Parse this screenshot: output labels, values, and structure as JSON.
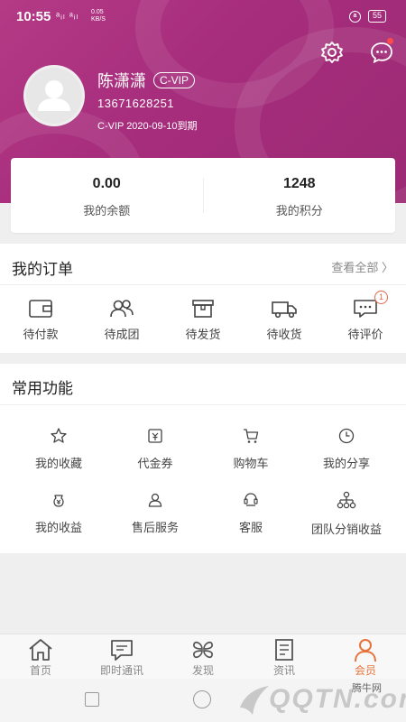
{
  "status_bar": {
    "time": "10:55",
    "signal": "ᵃᵢₗ ᵃᵢₗ",
    "speed_value": "0.05",
    "speed_unit": "KB/S",
    "battery": "55"
  },
  "profile": {
    "name": "陈潇潇",
    "vip_badge": "C-VIP",
    "phone": "13671628251",
    "expiry": "C-VIP 2020-09-10到期"
  },
  "balance": {
    "amount_value": "0.00",
    "amount_label": "我的余额",
    "points_value": "1248",
    "points_label": "我的积分"
  },
  "orders": {
    "title": "我的订单",
    "see_all": "查看全部 〉",
    "items": [
      {
        "label": "待付款",
        "icon": "wallet-icon"
      },
      {
        "label": "待成团",
        "icon": "group-icon"
      },
      {
        "label": "待发货",
        "icon": "box-icon"
      },
      {
        "label": "待收货",
        "icon": "truck-icon"
      },
      {
        "label": "待评价",
        "icon": "comment-icon",
        "badge": "1"
      }
    ]
  },
  "functions": {
    "title": "常用功能",
    "items": [
      {
        "label": "我的收藏",
        "icon": "star-icon"
      },
      {
        "label": "代金券",
        "icon": "coupon-icon"
      },
      {
        "label": "购物车",
        "icon": "cart-icon"
      },
      {
        "label": "我的分享",
        "icon": "share-clock-icon"
      },
      {
        "label": "我的收益",
        "icon": "earnings-icon"
      },
      {
        "label": "售后服务",
        "icon": "after-sales-icon"
      },
      {
        "label": "客服",
        "icon": "customer-service-icon"
      },
      {
        "label": "团队分销收益",
        "icon": "team-icon"
      }
    ]
  },
  "tabbar": {
    "items": [
      {
        "label": "首页",
        "icon": "home-icon"
      },
      {
        "label": "即时通讯",
        "icon": "chat-icon"
      },
      {
        "label": "发现",
        "icon": "discover-icon"
      },
      {
        "label": "资讯",
        "icon": "news-icon"
      },
      {
        "label": "会员",
        "icon": "member-icon",
        "active": true
      }
    ]
  },
  "watermark": {
    "text": "QQTN.com",
    "site": "腾牛网"
  },
  "colors": {
    "header": "#a62d7c",
    "accent": "#e5733b",
    "badge": "#e5664b"
  }
}
